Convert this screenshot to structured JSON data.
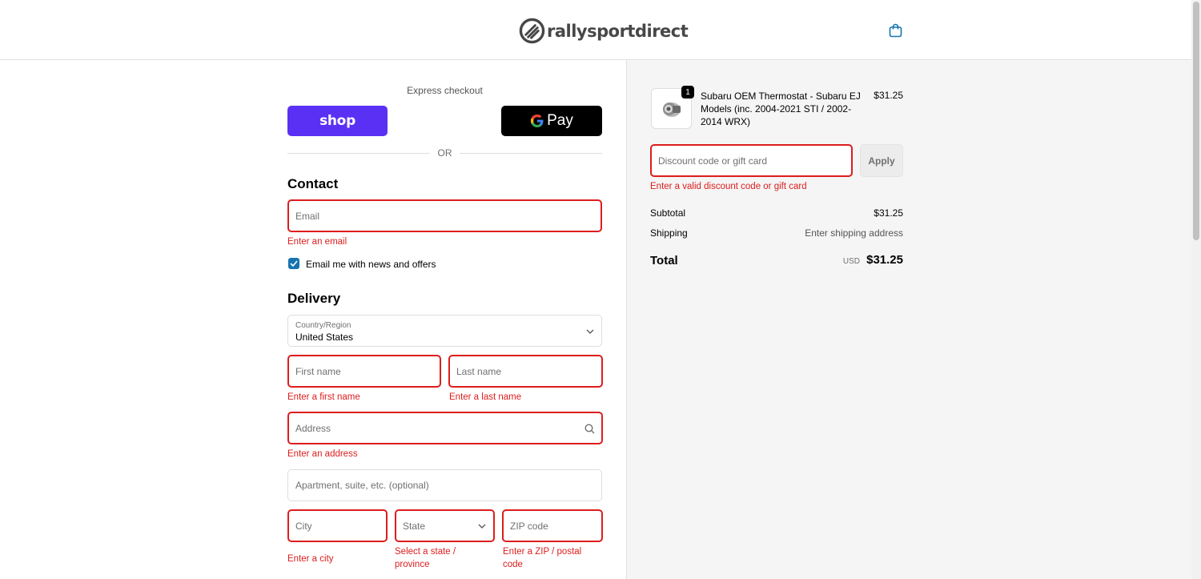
{
  "header": {
    "logo_text": "rallysportdirect",
    "cart_icon": "shopping-bag-icon"
  },
  "express": {
    "title": "Express checkout",
    "shop_label": "shop",
    "gpay_label": "Pay",
    "or_text": "OR"
  },
  "contact": {
    "heading": "Contact",
    "email_placeholder": "Email",
    "email_error": "Enter an email",
    "newsletter_label": "Email me with news and offers",
    "newsletter_checked": true
  },
  "delivery": {
    "heading": "Delivery",
    "country_label": "Country/Region",
    "country_value": "United States",
    "first_name_placeholder": "First name",
    "first_name_error": "Enter a first name",
    "last_name_placeholder": "Last name",
    "last_name_error": "Enter a last name",
    "address_placeholder": "Address",
    "address_error": "Enter an address",
    "apartment_placeholder": "Apartment, suite, etc. (optional)",
    "city_placeholder": "City",
    "city_error": "Enter a city",
    "state_placeholder": "State",
    "state_error": "Select a state / province",
    "zip_placeholder": "ZIP code",
    "zip_error": "Enter a ZIP / postal code"
  },
  "summary": {
    "item": {
      "quantity": "1",
      "name": "Subaru OEM Thermostat - Subaru EJ Models (inc. 2004-2021 STI / 2002-2014 WRX)",
      "price": "$31.25"
    },
    "discount_placeholder": "Discount code or gift card",
    "discount_error": "Enter a valid discount code or gift card",
    "apply_label": "Apply",
    "subtotal_label": "Subtotal",
    "subtotal_value": "$31.25",
    "shipping_label": "Shipping",
    "shipping_value": "Enter shipping address",
    "total_label": "Total",
    "total_currency": "USD",
    "total_value": "$31.25"
  },
  "colors": {
    "error": "#dd1d1d",
    "shop_purple": "#5a31f4",
    "accent_blue": "#1773b0"
  }
}
